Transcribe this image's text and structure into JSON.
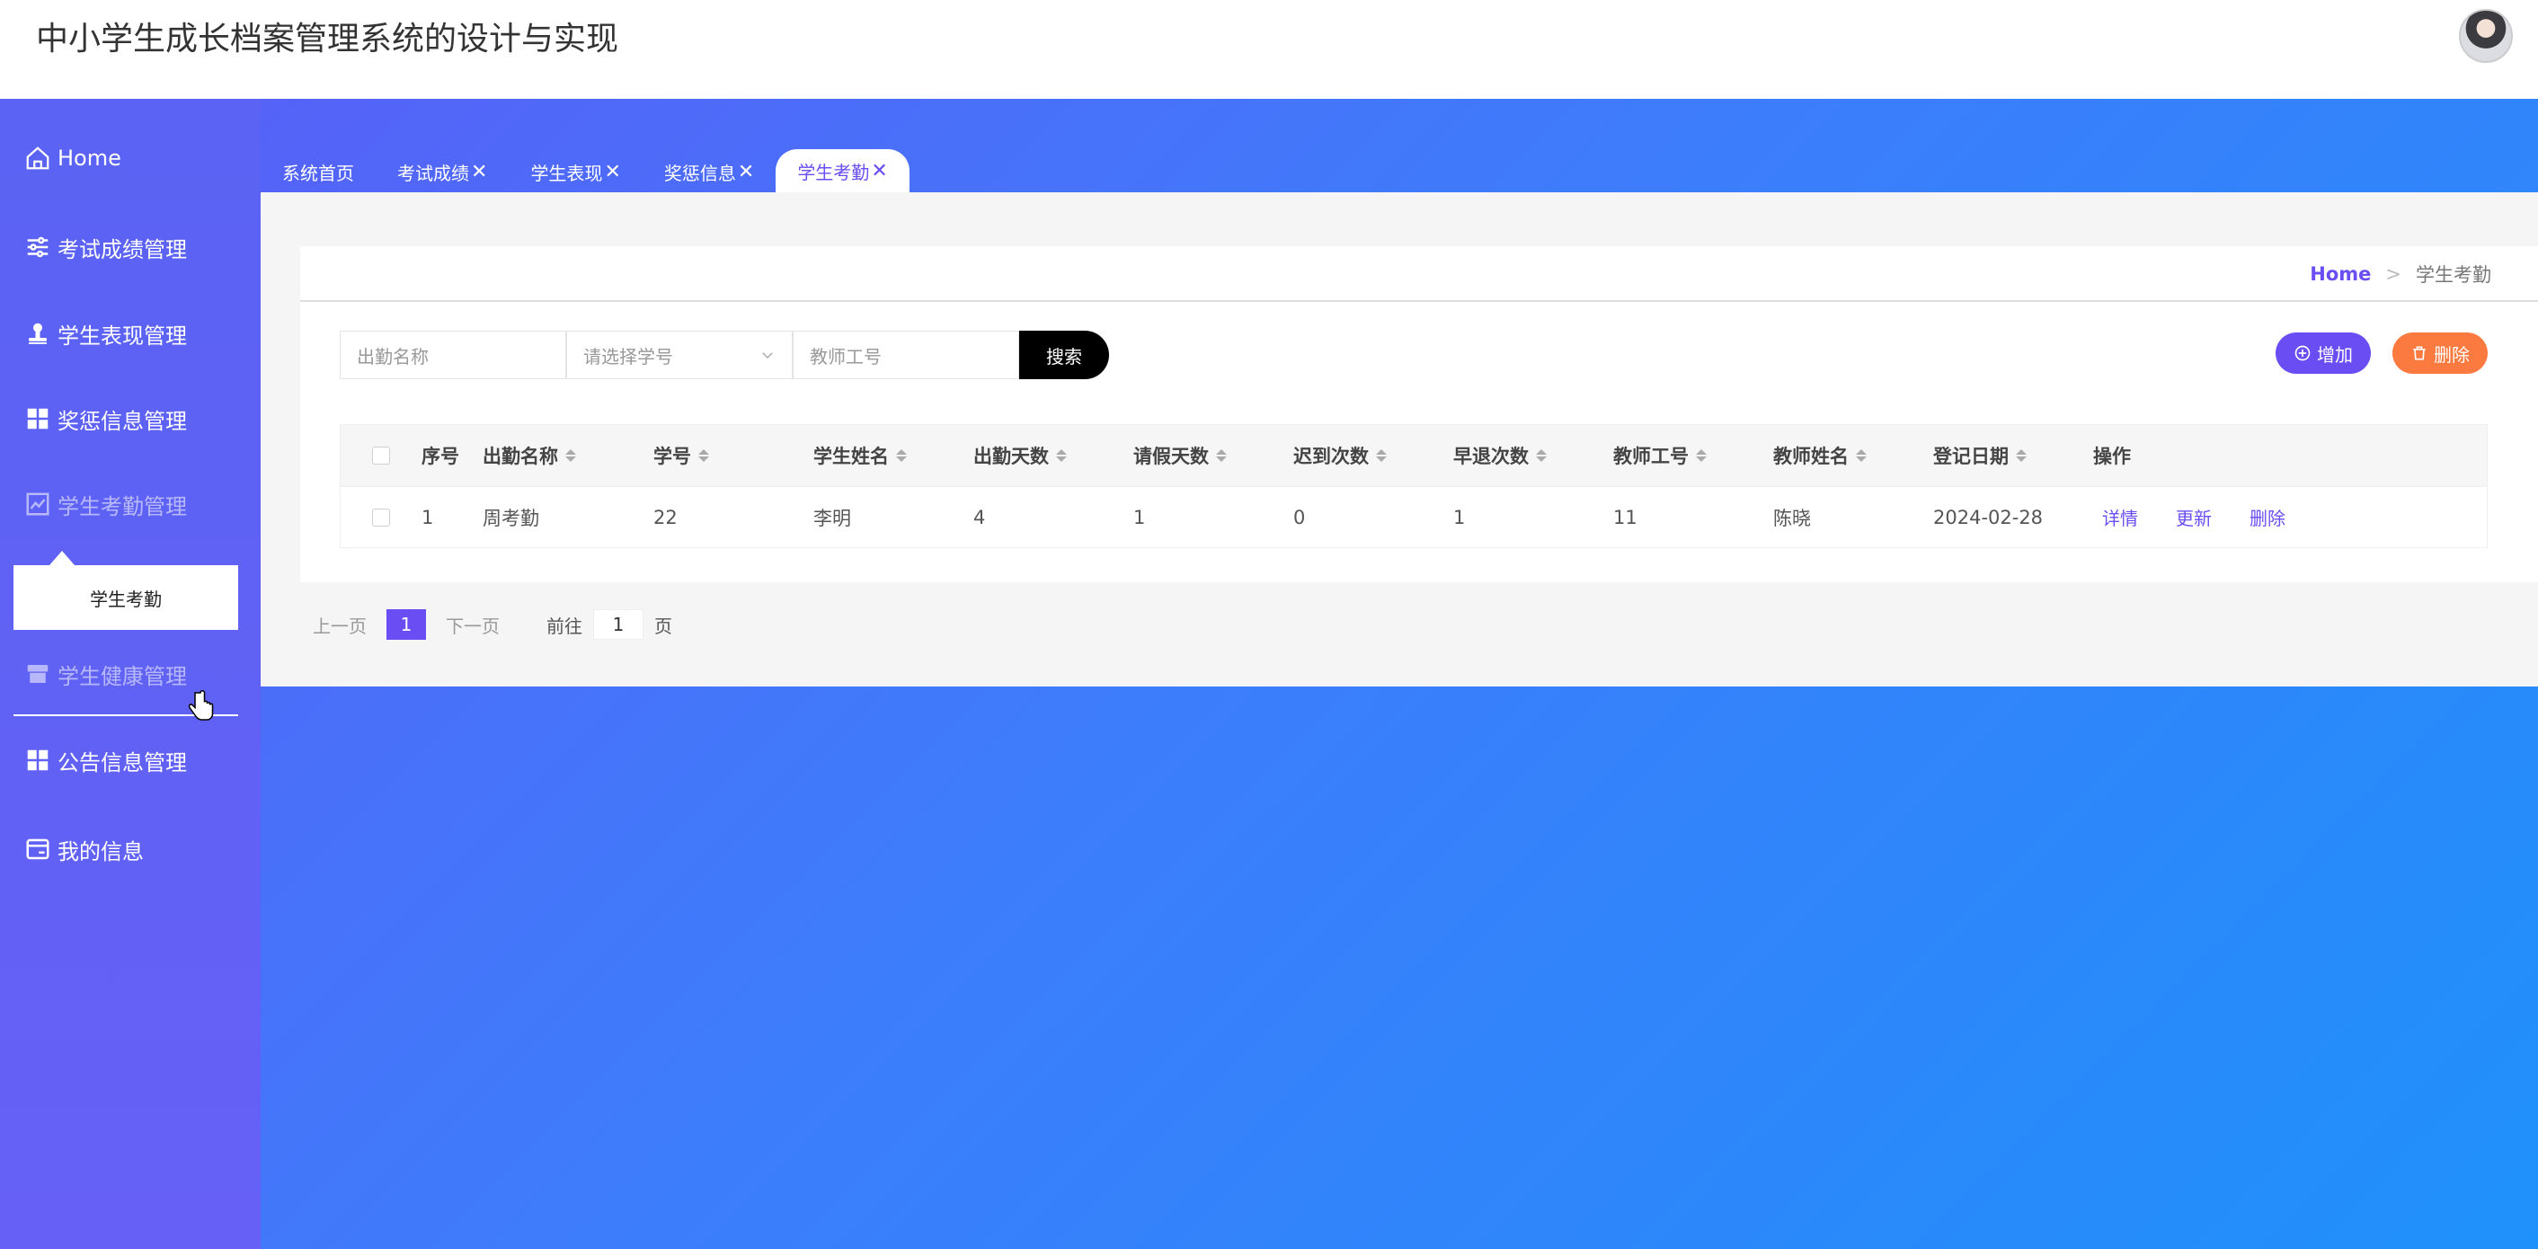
{
  "app": {
    "title": "中小学生成长档案管理系统的设计与实现"
  },
  "sidebar": {
    "items": [
      {
        "label": "Home",
        "icon": "home-icon"
      },
      {
        "label": "考试成绩管理",
        "icon": "sliders-icon"
      },
      {
        "label": "学生表现管理",
        "icon": "stamp-icon"
      },
      {
        "label": "奖惩信息管理",
        "icon": "grid-icon"
      },
      {
        "label": "学生考勤管理",
        "icon": "chart-icon"
      },
      {
        "label": "学生健康管理",
        "icon": "shop-icon"
      },
      {
        "label": "公告信息管理",
        "icon": "grid-icon"
      },
      {
        "label": "我的信息",
        "icon": "card-icon"
      }
    ],
    "submenu_label": "学生考勤"
  },
  "tabs": [
    {
      "label": "系统首页",
      "closable": false
    },
    {
      "label": "考试成绩",
      "closable": true
    },
    {
      "label": "学生表现",
      "closable": true
    },
    {
      "label": "奖惩信息",
      "closable": true
    },
    {
      "label": "学生考勤",
      "closable": true,
      "active": true
    }
  ],
  "tab_close_glyph": "✕",
  "breadcrumb": {
    "home": "Home",
    "separator": ">",
    "current": "学生考勤"
  },
  "search": {
    "name_placeholder": "出勤名称",
    "student_placeholder": "请选择学号",
    "teacher_placeholder": "教师工号",
    "search_label": "搜索"
  },
  "actions": {
    "add_label": "增加",
    "delete_label": "删除"
  },
  "table": {
    "columns": [
      "序号",
      "出勤名称",
      "学号",
      "学生姓名",
      "出勤天数",
      "请假天数",
      "迟到次数",
      "早退次数",
      "教师工号",
      "教师姓名",
      "登记日期",
      "操作"
    ],
    "rows": [
      [
        "1",
        "周考勤",
        "22",
        "李明",
        "4",
        "1",
        "0",
        "1",
        "11",
        "陈晓",
        "2024-02-28"
      ]
    ],
    "row_actions": [
      "详情",
      "更新",
      "删除"
    ]
  },
  "pagination": {
    "prev_label": "上一页",
    "current_page": "1",
    "next_label": "下一页",
    "goto_prefix": "前往",
    "goto_value": "1",
    "goto_suffix": "页"
  },
  "colors": {
    "accent": "#6a4df3",
    "delete": "#fb7a3f",
    "search_button": "#000000"
  }
}
